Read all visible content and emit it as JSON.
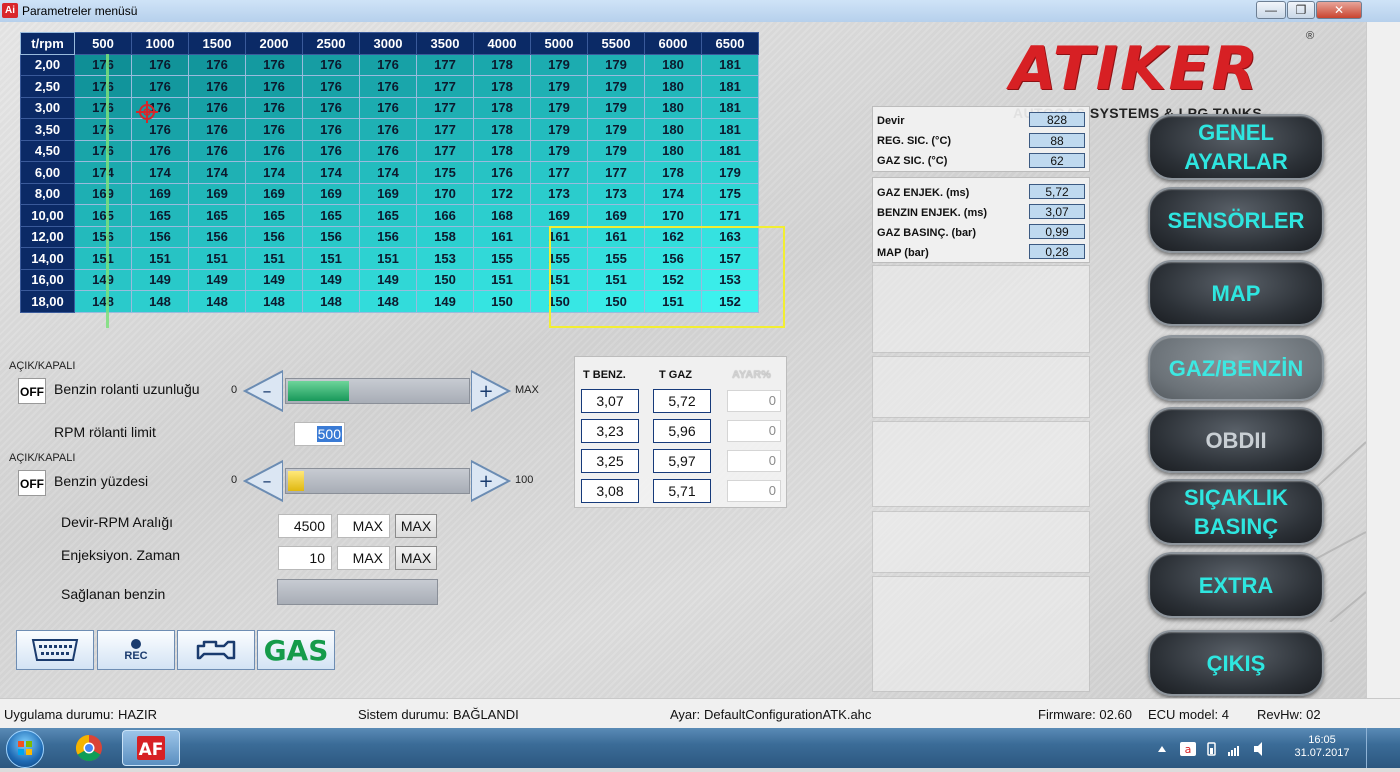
{
  "window": {
    "title": "Parametreler menüsü",
    "app_icon": "Ai"
  },
  "map": {
    "corner": "t/rpm",
    "columns": [
      "500",
      "1000",
      "1500",
      "2000",
      "2500",
      "3000",
      "3500",
      "4000",
      "5000",
      "5500",
      "6000",
      "6500"
    ],
    "rows": [
      {
        "label": "2,00",
        "values": [
          "176",
          "176",
          "176",
          "176",
          "176",
          "176",
          "177",
          "178",
          "179",
          "179",
          "180",
          "181"
        ]
      },
      {
        "label": "2,50",
        "values": [
          "176",
          "176",
          "176",
          "176",
          "176",
          "176",
          "177",
          "178",
          "179",
          "179",
          "180",
          "181"
        ]
      },
      {
        "label": "3,00",
        "values": [
          "176",
          "176",
          "176",
          "176",
          "176",
          "176",
          "177",
          "178",
          "179",
          "179",
          "180",
          "181"
        ]
      },
      {
        "label": "3,50",
        "values": [
          "176",
          "176",
          "176",
          "176",
          "176",
          "176",
          "177",
          "178",
          "179",
          "179",
          "180",
          "181"
        ]
      },
      {
        "label": "4,50",
        "values": [
          "176",
          "176",
          "176",
          "176",
          "176",
          "176",
          "177",
          "178",
          "179",
          "179",
          "180",
          "181"
        ]
      },
      {
        "label": "6,00",
        "values": [
          "174",
          "174",
          "174",
          "174",
          "174",
          "174",
          "175",
          "176",
          "177",
          "177",
          "178",
          "179"
        ]
      },
      {
        "label": "8,00",
        "values": [
          "169",
          "169",
          "169",
          "169",
          "169",
          "169",
          "170",
          "172",
          "173",
          "173",
          "174",
          "175"
        ]
      },
      {
        "label": "10,00",
        "values": [
          "165",
          "165",
          "165",
          "165",
          "165",
          "165",
          "166",
          "168",
          "169",
          "169",
          "170",
          "171"
        ]
      },
      {
        "label": "12,00",
        "values": [
          "156",
          "156",
          "156",
          "156",
          "156",
          "156",
          "158",
          "161",
          "161",
          "161",
          "162",
          "163"
        ]
      },
      {
        "label": "14,00",
        "values": [
          "151",
          "151",
          "151",
          "151",
          "151",
          "151",
          "153",
          "155",
          "155",
          "155",
          "156",
          "157"
        ]
      },
      {
        "label": "16,00",
        "values": [
          "149",
          "149",
          "149",
          "149",
          "149",
          "149",
          "150",
          "151",
          "151",
          "151",
          "152",
          "153"
        ]
      },
      {
        "label": "18,00",
        "values": [
          "148",
          "148",
          "148",
          "148",
          "148",
          "148",
          "149",
          "150",
          "150",
          "150",
          "151",
          "152"
        ]
      }
    ]
  },
  "logo": {
    "brand": "ATIKER",
    "reg": "®",
    "subtitle": "AUTOGAS SYSTEMS & LPG TANKS"
  },
  "sensors": {
    "group1": [
      {
        "label": "Devir",
        "value": "828"
      },
      {
        "label": "REG. SIC. (°C)",
        "value": "88"
      },
      {
        "label": "GAZ SIC. (°C)",
        "value": "62"
      }
    ],
    "group2": [
      {
        "label": "GAZ ENJEK. (ms)",
        "value": "5,72"
      },
      {
        "label": "BENZIN ENJEK. (ms)",
        "value": "3,07"
      },
      {
        "label": "GAZ BASINÇ. (bar)",
        "value": "0,99"
      },
      {
        "label": "MAP (bar)",
        "value": "0,28"
      }
    ]
  },
  "nav": {
    "genel": "GENEL\nAYARLAR",
    "sensorler": "SENSÖRLER",
    "map": "MAP",
    "gaz_benzin": "GAZ/BENZİN",
    "obdii": "OBDII",
    "sicaklik": "SIÇAKLIK\nBASINÇ",
    "extra": "EXTRA",
    "cikis": "ÇIKIŞ"
  },
  "controls": {
    "acik_kapali": "AÇIK/KAPALI",
    "off": "OFF",
    "benzin_rolanti": "Benzin rolanti uzunluğu",
    "rolanti_min": "0",
    "rolanti_max": "MAX",
    "rolanti_level": 0.34,
    "rpm_rolanti_label": "RPM rölanti limit",
    "rpm_rolanti_value": "500",
    "benzin_yuzdesi": "Benzin yüzdesi",
    "yuzde_min": "0",
    "yuzde_max": "100",
    "yuzde_level": 0.09,
    "devir_label": "Devir-RPM Aralığı",
    "devir_value": "4500",
    "devir_max_field": "MAX",
    "devir_max_btn": "MAX",
    "enjeksiyon_label": "Enjeksiyon. Zaman",
    "enjeksiyon_value": "10",
    "enjeksiyon_max_field": "MAX",
    "enjeksiyon_max_btn": "MAX",
    "saglanan_label": "Sağlanan benzin"
  },
  "tbenz": {
    "headers": [
      "T BENZ.",
      "T GAZ",
      "AYAR%"
    ],
    "rows": [
      {
        "benz": "3,07",
        "gaz": "5,72",
        "ayar": "0"
      },
      {
        "benz": "3,23",
        "gaz": "5,96",
        "ayar": "0"
      },
      {
        "benz": "3,25",
        "gaz": "5,97",
        "ayar": "0"
      },
      {
        "benz": "3,08",
        "gaz": "5,71",
        "ayar": "0"
      }
    ]
  },
  "toolbar": {
    "rec": "REC",
    "gas": "GAS"
  },
  "status": {
    "uygulama_label": "Uygulama durumu:",
    "uygulama_value": "HAZIR",
    "sistem_label": "Sistem durumu:",
    "sistem_value": "BAĞLANDI",
    "ayar_label": "Ayar:",
    "ayar_value": "DefaultConfigurationATK.ahc",
    "firmware": "Firmware: 02.60",
    "ecu": "ECU model: 4",
    "revhw": "RevHw: 02"
  },
  "taskbar": {
    "time": "16:05",
    "date": "31.07.2017"
  },
  "colors": {
    "accent": "#2ee6e0",
    "brand": "#d72024",
    "header": "#0b2a66",
    "highlight": "#f2ee32"
  }
}
